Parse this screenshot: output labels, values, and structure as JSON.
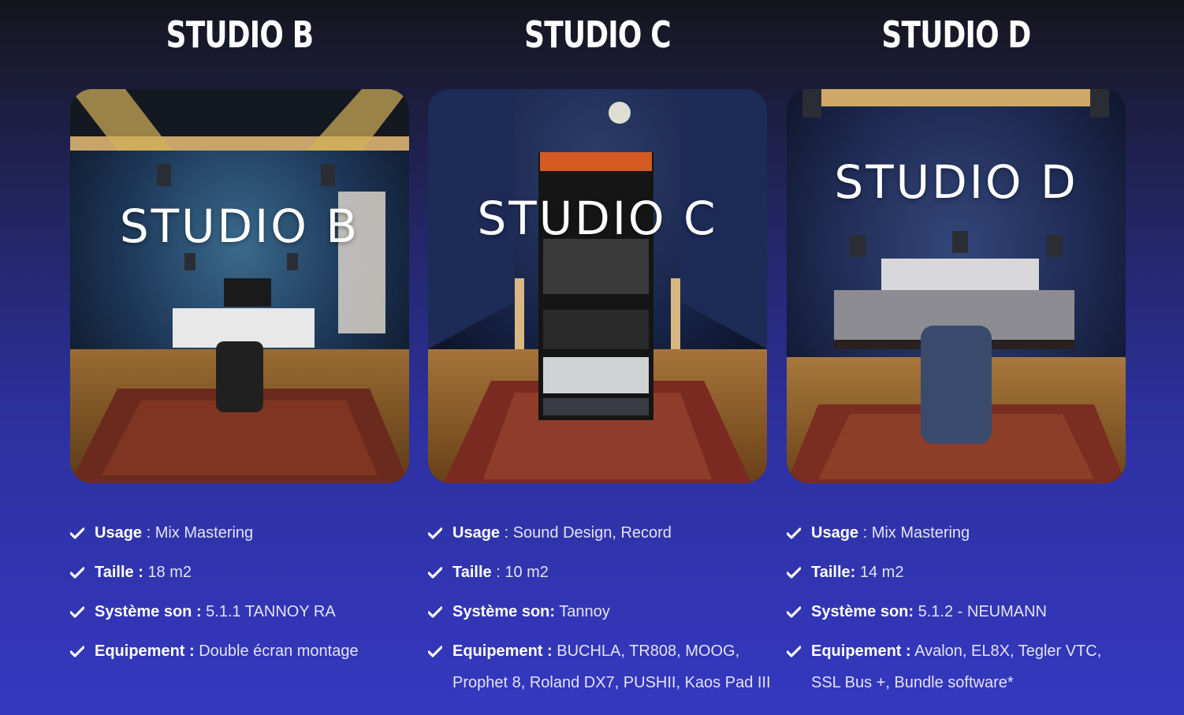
{
  "studios": [
    {
      "heading": "STUDIO B",
      "photo_title": "STUDIO B",
      "features": [
        {
          "key": "Usage",
          "sep": " : ",
          "value": "Mix Mastering"
        },
        {
          "key": "Taille :",
          "sep": " ",
          "value": "18 m2"
        },
        {
          "key": "Système son :",
          "sep": " ",
          "value": "5.1.1 TANNOY RA"
        },
        {
          "key": "Equipement :",
          "sep": " ",
          "value": "Double écran montage"
        }
      ]
    },
    {
      "heading": "STUDIO C",
      "photo_title": "STUDIO C",
      "features": [
        {
          "key": "Usage",
          "sep": " : ",
          "value": "Sound Design, Record"
        },
        {
          "key": "Taille",
          "sep": " : ",
          "value": "10 m2"
        },
        {
          "key": "Système son:",
          "sep": " ",
          "value": "Tannoy"
        },
        {
          "key": "Equipement :",
          "sep": " ",
          "value": "BUCHLA, TR808, MOOG, Prophet 8, Roland DX7, PUSHII, Kaos Pad III"
        }
      ]
    },
    {
      "heading": "STUDIO D",
      "photo_title": "STUDIO D",
      "features": [
        {
          "key": "Usage",
          "sep": " : ",
          "value": "Mix Mastering"
        },
        {
          "key": "Taille:",
          "sep": " ",
          "value": "14 m2"
        },
        {
          "key": "Système son:",
          "sep": " ",
          "value": "5.1.2 - NEUMANN"
        },
        {
          "key": "Equipement :",
          "sep": " ",
          "value": "Avalon, EL8X, Tegler VTC, SSL Bus +, Bundle software*"
        }
      ]
    }
  ],
  "icons": {
    "bullet": "check-icon"
  },
  "colors": {
    "background_top": "#15151d",
    "background_bottom": "#3438bf",
    "text": "#ffffff"
  }
}
